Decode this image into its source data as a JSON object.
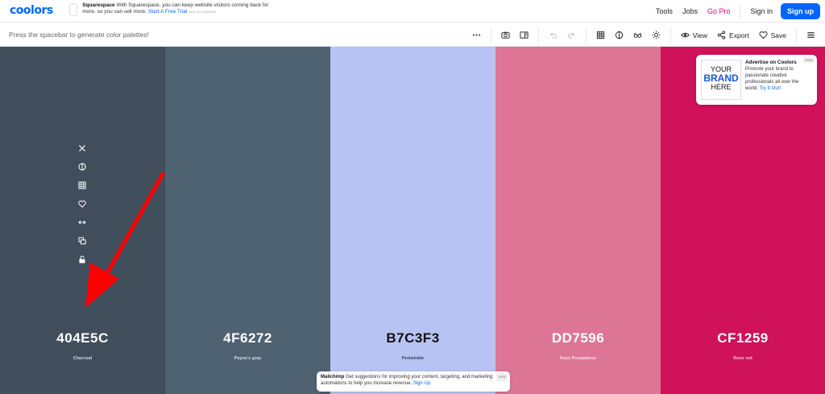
{
  "header": {
    "logo": "coolors",
    "ad": {
      "title": "Squarespace",
      "text": "With Squarespace, you can keep website visitors coming back for more, so you can sell more.",
      "cta": "Start A Free Trial",
      "tag": "ADS VIA CARBON"
    },
    "nav": {
      "tools": "Tools",
      "jobs": "Jobs",
      "gopro": "Go Pro",
      "signin": "Sign in",
      "signup": "Sign up"
    }
  },
  "toolbar": {
    "hint": "Press the spacebar to generate color palettes!",
    "view": "View",
    "export": "Export",
    "save": "Save"
  },
  "palette": [
    {
      "hex": "404E5C",
      "name": "Charcoal",
      "color": "#404E5C",
      "text_color": "#ffffff"
    },
    {
      "hex": "4F6272",
      "name": "Payne's gray",
      "color": "#4F6272",
      "text_color": "#ffffff"
    },
    {
      "hex": "B7C3F3",
      "name": "Periwinkle",
      "color": "#B7C3F3",
      "text_color": "#111111"
    },
    {
      "hex": "DD7596",
      "name": "Rose Pompadour",
      "color": "#DD7596",
      "text_color": "#ffffff"
    },
    {
      "hex": "CF1259",
      "name": "Rose red",
      "color": "#CF1259",
      "text_color": "#ffffff"
    }
  ],
  "side_tools": [
    "close-icon",
    "contrast-icon",
    "grid-icon",
    "heart-icon",
    "drag-icon",
    "copy-icon",
    "lock-icon"
  ],
  "ad_card": {
    "brand_line1": "YOUR",
    "brand_line2": "BRAND",
    "brand_line3": "HERE",
    "title": "Advertise on Coolors",
    "text": "Promote your brand to passionate creative professionals all over the world.",
    "cta": "Try It Out!",
    "hide": "HIDE"
  },
  "ad_bottom": {
    "title": "Mailchimp",
    "text": "Get suggestions for improving your content, targeting, and marketing automations to help you increase revenue.",
    "cta": "Sign Up",
    "hide": "HIDE"
  },
  "colors": {
    "accent": "#0066ff",
    "gopro": "#ff0080",
    "arrow": "#ff0000"
  }
}
